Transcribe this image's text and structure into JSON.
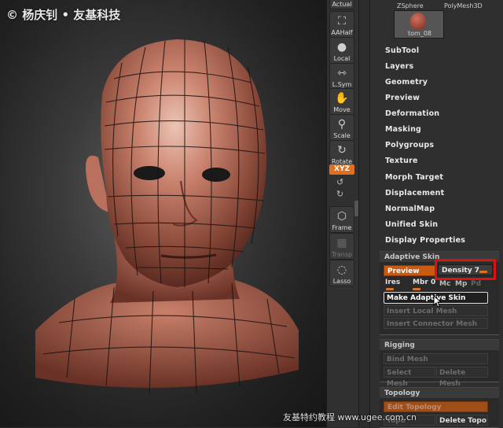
{
  "watermark": {
    "top": "© 杨庆钊 • 友基科技",
    "bottom": "友基特约教程  www.ugee.com.cn"
  },
  "shelf": {
    "top_cut_label": "Actual",
    "aahalf": "AAHalf",
    "local": "Local",
    "lsym": "L.Sym",
    "move": "Move",
    "scale": "Scale",
    "rotate": "Rotate",
    "xyz": "XYZ",
    "frame": "Frame",
    "transp": "Transp",
    "lasso": "Lasso"
  },
  "tool": {
    "zsphere": "ZSphere",
    "polymesh": "PolyMesh3D",
    "thumb_name": "tom_08"
  },
  "menu": [
    "SubTool",
    "Layers",
    "Geometry",
    "Preview",
    "Deformation",
    "Masking",
    "Polygroups",
    "Texture",
    "Morph Target",
    "Displacement",
    "NormalMap",
    "Unified Skin",
    "Display Properties"
  ],
  "adaptive_skin": {
    "header": "Adaptive Skin",
    "preview": "Preview",
    "density": "Density 7",
    "ires": "Ires",
    "mbr": "Mbr 0",
    "mc": "Mc",
    "mp": "Mp",
    "pd": "Pd",
    "make": "Make Adaptive Skin",
    "insert_local": "Insert Local Mesh",
    "insert_connector": "Insert Connector Mesh"
  },
  "rigging": {
    "header": "Rigging",
    "bind": "Bind Mesh",
    "select": "Select Mesh",
    "delete": "Delete Mesh"
  },
  "topology": {
    "header": "Topology",
    "edit": "Edit Topology",
    "topo": "Topo",
    "delete": "Delete Topo"
  },
  "colors": {
    "accent": "#e07020",
    "highlight": "#e01010",
    "skin": "#c47a68"
  }
}
